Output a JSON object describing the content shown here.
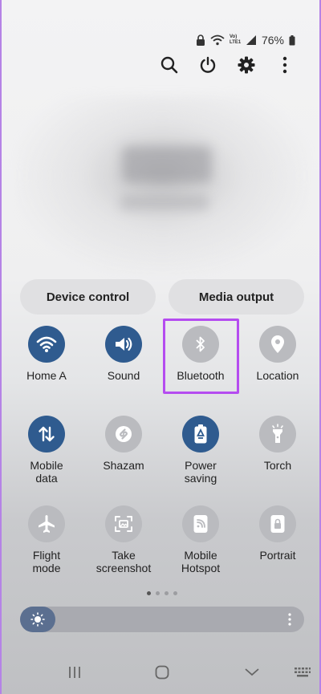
{
  "status": {
    "battery_percent": "76%",
    "network_label": "Vo) LTE1"
  },
  "top_actions": [
    "search-icon",
    "power-icon",
    "gear-icon",
    "more-vertical-icon"
  ],
  "controls": {
    "device_control": "Device control",
    "media_output": "Media output"
  },
  "tiles": [
    {
      "label": "Home A",
      "icon": "wifi-icon",
      "state": "on"
    },
    {
      "label": "Sound",
      "icon": "speaker-icon",
      "state": "on"
    },
    {
      "label": "Bluetooth",
      "icon": "bluetooth-icon",
      "state": "off"
    },
    {
      "label": "Location",
      "icon": "location-pin-icon",
      "state": "off"
    },
    {
      "label": "Mobile\ndata",
      "icon": "mobile-data-icon",
      "state": "on"
    },
    {
      "label": "Shazam",
      "icon": "shazam-icon",
      "state": "off"
    },
    {
      "label": "Power\nsaving",
      "icon": "power-saving-icon",
      "state": "on"
    },
    {
      "label": "Torch",
      "icon": "torch-icon",
      "state": "off"
    },
    {
      "label": "Flight\nmode",
      "icon": "airplane-icon",
      "state": "off"
    },
    {
      "label": "Take\nscreenshot",
      "icon": "screenshot-icon",
      "state": "off"
    },
    {
      "label": "Mobile\nHotspot",
      "icon": "hotspot-icon",
      "state": "off"
    },
    {
      "label": "Portrait",
      "icon": "portrait-lock-icon",
      "state": "off"
    }
  ],
  "pager": {
    "pages": 4,
    "current": 1
  },
  "brightness": {
    "level": 0.06
  },
  "colors": {
    "tile_on": "#2f5b8f",
    "tile_off": "#babbbf",
    "highlight": "#b54cf0"
  }
}
